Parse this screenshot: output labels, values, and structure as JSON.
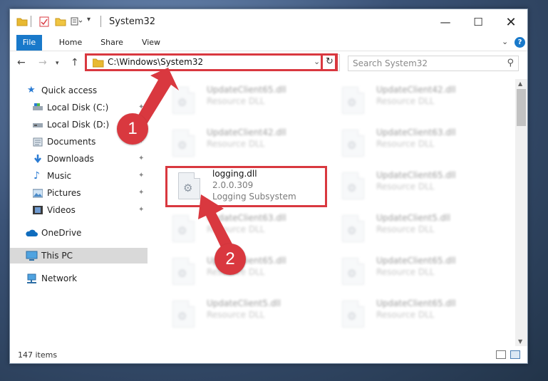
{
  "window": {
    "title": "System32",
    "controls": [
      "minimize",
      "maximize",
      "close"
    ]
  },
  "ribbon": {
    "tabs": [
      "File",
      "Home",
      "Share",
      "View"
    ],
    "help": "?"
  },
  "address_bar": {
    "path": "C:\\Windows\\System32"
  },
  "search": {
    "placeholder": "Search System32"
  },
  "sidebar": {
    "items": [
      {
        "label": "Quick access",
        "icon": "star-icon",
        "pinned": false
      },
      {
        "label": "Local Disk (C:)",
        "icon": "drive-icon",
        "pinned": true
      },
      {
        "label": "Local Disk (D:)",
        "icon": "drive-icon",
        "pinned": true
      },
      {
        "label": "Documents",
        "icon": "documents-icon",
        "pinned": true
      },
      {
        "label": "Downloads",
        "icon": "download-icon",
        "pinned": true
      },
      {
        "label": "Music",
        "icon": "music-icon",
        "pinned": true
      },
      {
        "label": "Pictures",
        "icon": "pictures-icon",
        "pinned": true
      },
      {
        "label": "Videos",
        "icon": "videos-icon",
        "pinned": true
      },
      {
        "label": "OneDrive",
        "icon": "cloud-icon",
        "pinned": false
      },
      {
        "label": "This PC",
        "icon": "computer-icon",
        "pinned": false,
        "selected": true
      },
      {
        "label": "Network",
        "icon": "network-icon",
        "pinned": false
      }
    ]
  },
  "files": [
    {
      "name": "UpdateClient65.dll",
      "desc": "Resource DLL",
      "blurred": true
    },
    {
      "name": "UpdateClient42.dll",
      "desc": "Resource DLL",
      "blurred": true
    },
    {
      "name": "UpdateClient42.dll",
      "desc": "Resource DLL",
      "blurred": true
    },
    {
      "name": "UpdateClient63.dll",
      "desc": "Resource DLL",
      "blurred": true
    },
    {
      "name": "logging.dll",
      "version": "2.0.0.309",
      "desc": "Logging Subsystem",
      "blurred": false
    },
    {
      "name": "UpdateClient65.dll",
      "desc": "Resource DLL",
      "blurred": true
    },
    {
      "name": "UpdateClient63.dll",
      "desc": "Resource DLL",
      "blurred": true
    },
    {
      "name": "UpdateClient5.dll",
      "desc": "Resource DLL",
      "blurred": true
    },
    {
      "name": "UpdateClient65.dll",
      "desc": "Resource DLL",
      "blurred": true
    },
    {
      "name": "UpdateClient65.dll",
      "desc": "Resource DLL",
      "blurred": true
    },
    {
      "name": "UpdateClient5.dll",
      "desc": "Resource DLL",
      "blurred": true
    },
    {
      "name": "UpdateClient65.dll",
      "desc": "Resource DLL",
      "blurred": true
    }
  ],
  "status": {
    "item_count": "147 items"
  },
  "annotations": {
    "badge1": "1",
    "badge2": "2",
    "color": "#d9383f"
  }
}
